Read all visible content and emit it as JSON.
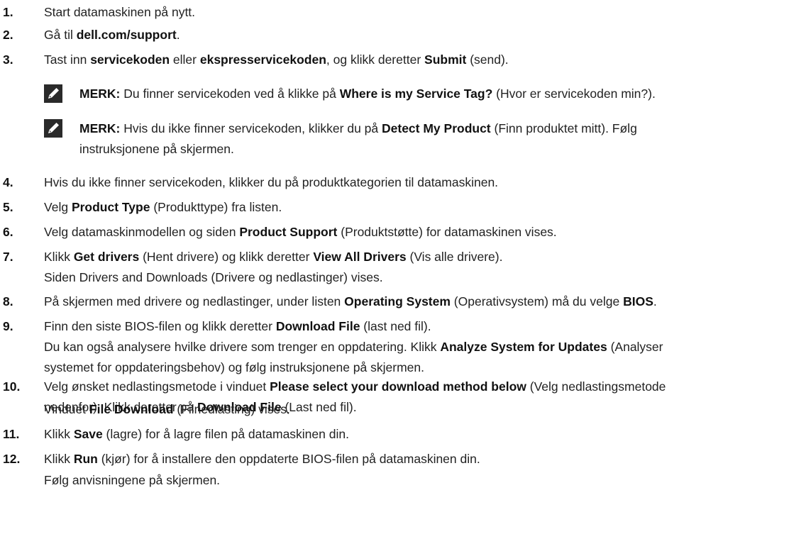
{
  "steps": [
    {
      "num": "1.",
      "lines": [
        [
          {
            "t": "Start datamaskinen på nytt."
          }
        ]
      ]
    },
    {
      "num": "2.",
      "lines": [
        [
          {
            "t": "Gå til "
          },
          {
            "t": "dell.com/support",
            "b": true
          },
          {
            "t": "."
          }
        ]
      ]
    },
    {
      "num": "3.",
      "lines": [
        [
          {
            "t": "Tast inn "
          },
          {
            "t": "servicekoden",
            "b": true
          },
          {
            "t": " eller "
          },
          {
            "t": "ekspresservicekoden",
            "b": true
          },
          {
            "t": ", og klikk deretter "
          },
          {
            "t": "Submit",
            "b": true
          },
          {
            "t": " (send)."
          }
        ]
      ]
    },
    {
      "note": true,
      "lines": [
        [
          {
            "t": "MERK:",
            "b": true
          },
          {
            "t": " Du finner servicekoden ved å klikke på "
          },
          {
            "t": "Where is my Service Tag?",
            "b": true
          },
          {
            "t": " (Hvor er servicekoden min?)."
          }
        ]
      ]
    },
    {
      "note": true,
      "lines": [
        [
          {
            "t": "MERK:",
            "b": true
          },
          {
            "t": " Hvis du ikke finner servicekoden, klikker du på "
          },
          {
            "t": "Detect My Product",
            "b": true
          },
          {
            "t": " (Finn produktet mitt). Følg"
          }
        ],
        [
          {
            "t": "instruksjonene på skjermen."
          }
        ]
      ]
    },
    {
      "num": "4.",
      "lines": [
        [
          {
            "t": "Hvis du ikke finner servicekoden, klikker du på produktkategorien til datamaskinen."
          }
        ]
      ]
    },
    {
      "num": "5.",
      "lines": [
        [
          {
            "t": "Velg "
          },
          {
            "t": "Product Type",
            "b": true
          },
          {
            "t": " (Produkttype) fra listen."
          }
        ]
      ]
    },
    {
      "num": "6.",
      "lines": [
        [
          {
            "t": "Velg datamaskinmodellen og siden "
          },
          {
            "t": "Product Support",
            "b": true
          },
          {
            "t": " (Produktstøtte) for datamaskinen vises."
          }
        ]
      ]
    },
    {
      "num": "7.",
      "lines": [
        [
          {
            "t": "Klikk "
          },
          {
            "t": "Get drivers",
            "b": true
          },
          {
            "t": " (Hent drivere) og klikk deretter "
          },
          {
            "t": "View All Drivers",
            "b": true
          },
          {
            "t": " (Vis alle drivere)."
          }
        ]
      ]
    },
    {
      "cont": true,
      "lines": [
        [
          {
            "t": "Siden Drivers and Downloads (Drivere og nedlastinger) vises."
          }
        ]
      ]
    },
    {
      "num": "8.",
      "lines": [
        [
          {
            "t": "På skjermen med drivere og nedlastinger, under listen "
          },
          {
            "t": "Operating System",
            "b": true
          },
          {
            "t": " (Operativsystem) må du velge "
          },
          {
            "t": "BIOS",
            "b": true
          },
          {
            "t": "."
          }
        ]
      ]
    },
    {
      "num": "9.",
      "lines": [
        [
          {
            "t": "Finn den siste BIOS-filen og klikk deretter "
          },
          {
            "t": "Download File",
            "b": true
          },
          {
            "t": " (last ned fil)."
          }
        ]
      ]
    },
    {
      "cont": true,
      "lines": [
        [
          {
            "t": "Du kan også analysere hvilke drivere som trenger en oppdatering. Klikk "
          },
          {
            "t": "Analyze System for Updates",
            "b": true
          },
          {
            "t": " (Analyser"
          }
        ],
        [
          {
            "t": "systemet for oppdateringsbehov) og følg instruksjonene på skjermen."
          }
        ]
      ]
    },
    {
      "num": "10.",
      "lines": [
        [
          {
            "t": "Velg ønsket nedlastingsmetode i vinduet "
          },
          {
            "t": "Please select your download method below",
            "b": true
          },
          {
            "t": " (Velg nedlastingsmetode"
          }
        ],
        [
          {
            "t": "nedenfor). Klikk deretter på "
          },
          {
            "t": "Download File",
            "b": true
          },
          {
            "t": " (Last ned fil)."
          }
        ]
      ]
    },
    {
      "cont": true,
      "lines": [
        [
          {
            "t": "Vinduet "
          },
          {
            "t": "File Download",
            "b": true
          },
          {
            "t": " (Filnedlasting) vises."
          }
        ]
      ]
    },
    {
      "num": "11.",
      "lines": [
        [
          {
            "t": "Klikk "
          },
          {
            "t": "Save",
            "b": true
          },
          {
            "t": " (lagre) for å lagre filen på datamaskinen din."
          }
        ]
      ]
    },
    {
      "num": "12.",
      "lines": [
        [
          {
            "t": "Klikk "
          },
          {
            "t": "Run",
            "b": true
          },
          {
            "t": " (kjør) for å installere den oppdaterte BIOS-filen på datamaskinen din."
          }
        ]
      ]
    },
    {
      "cont": true,
      "lines": [
        [
          {
            "t": "Følg anvisningene på skjermen."
          }
        ]
      ]
    }
  ]
}
